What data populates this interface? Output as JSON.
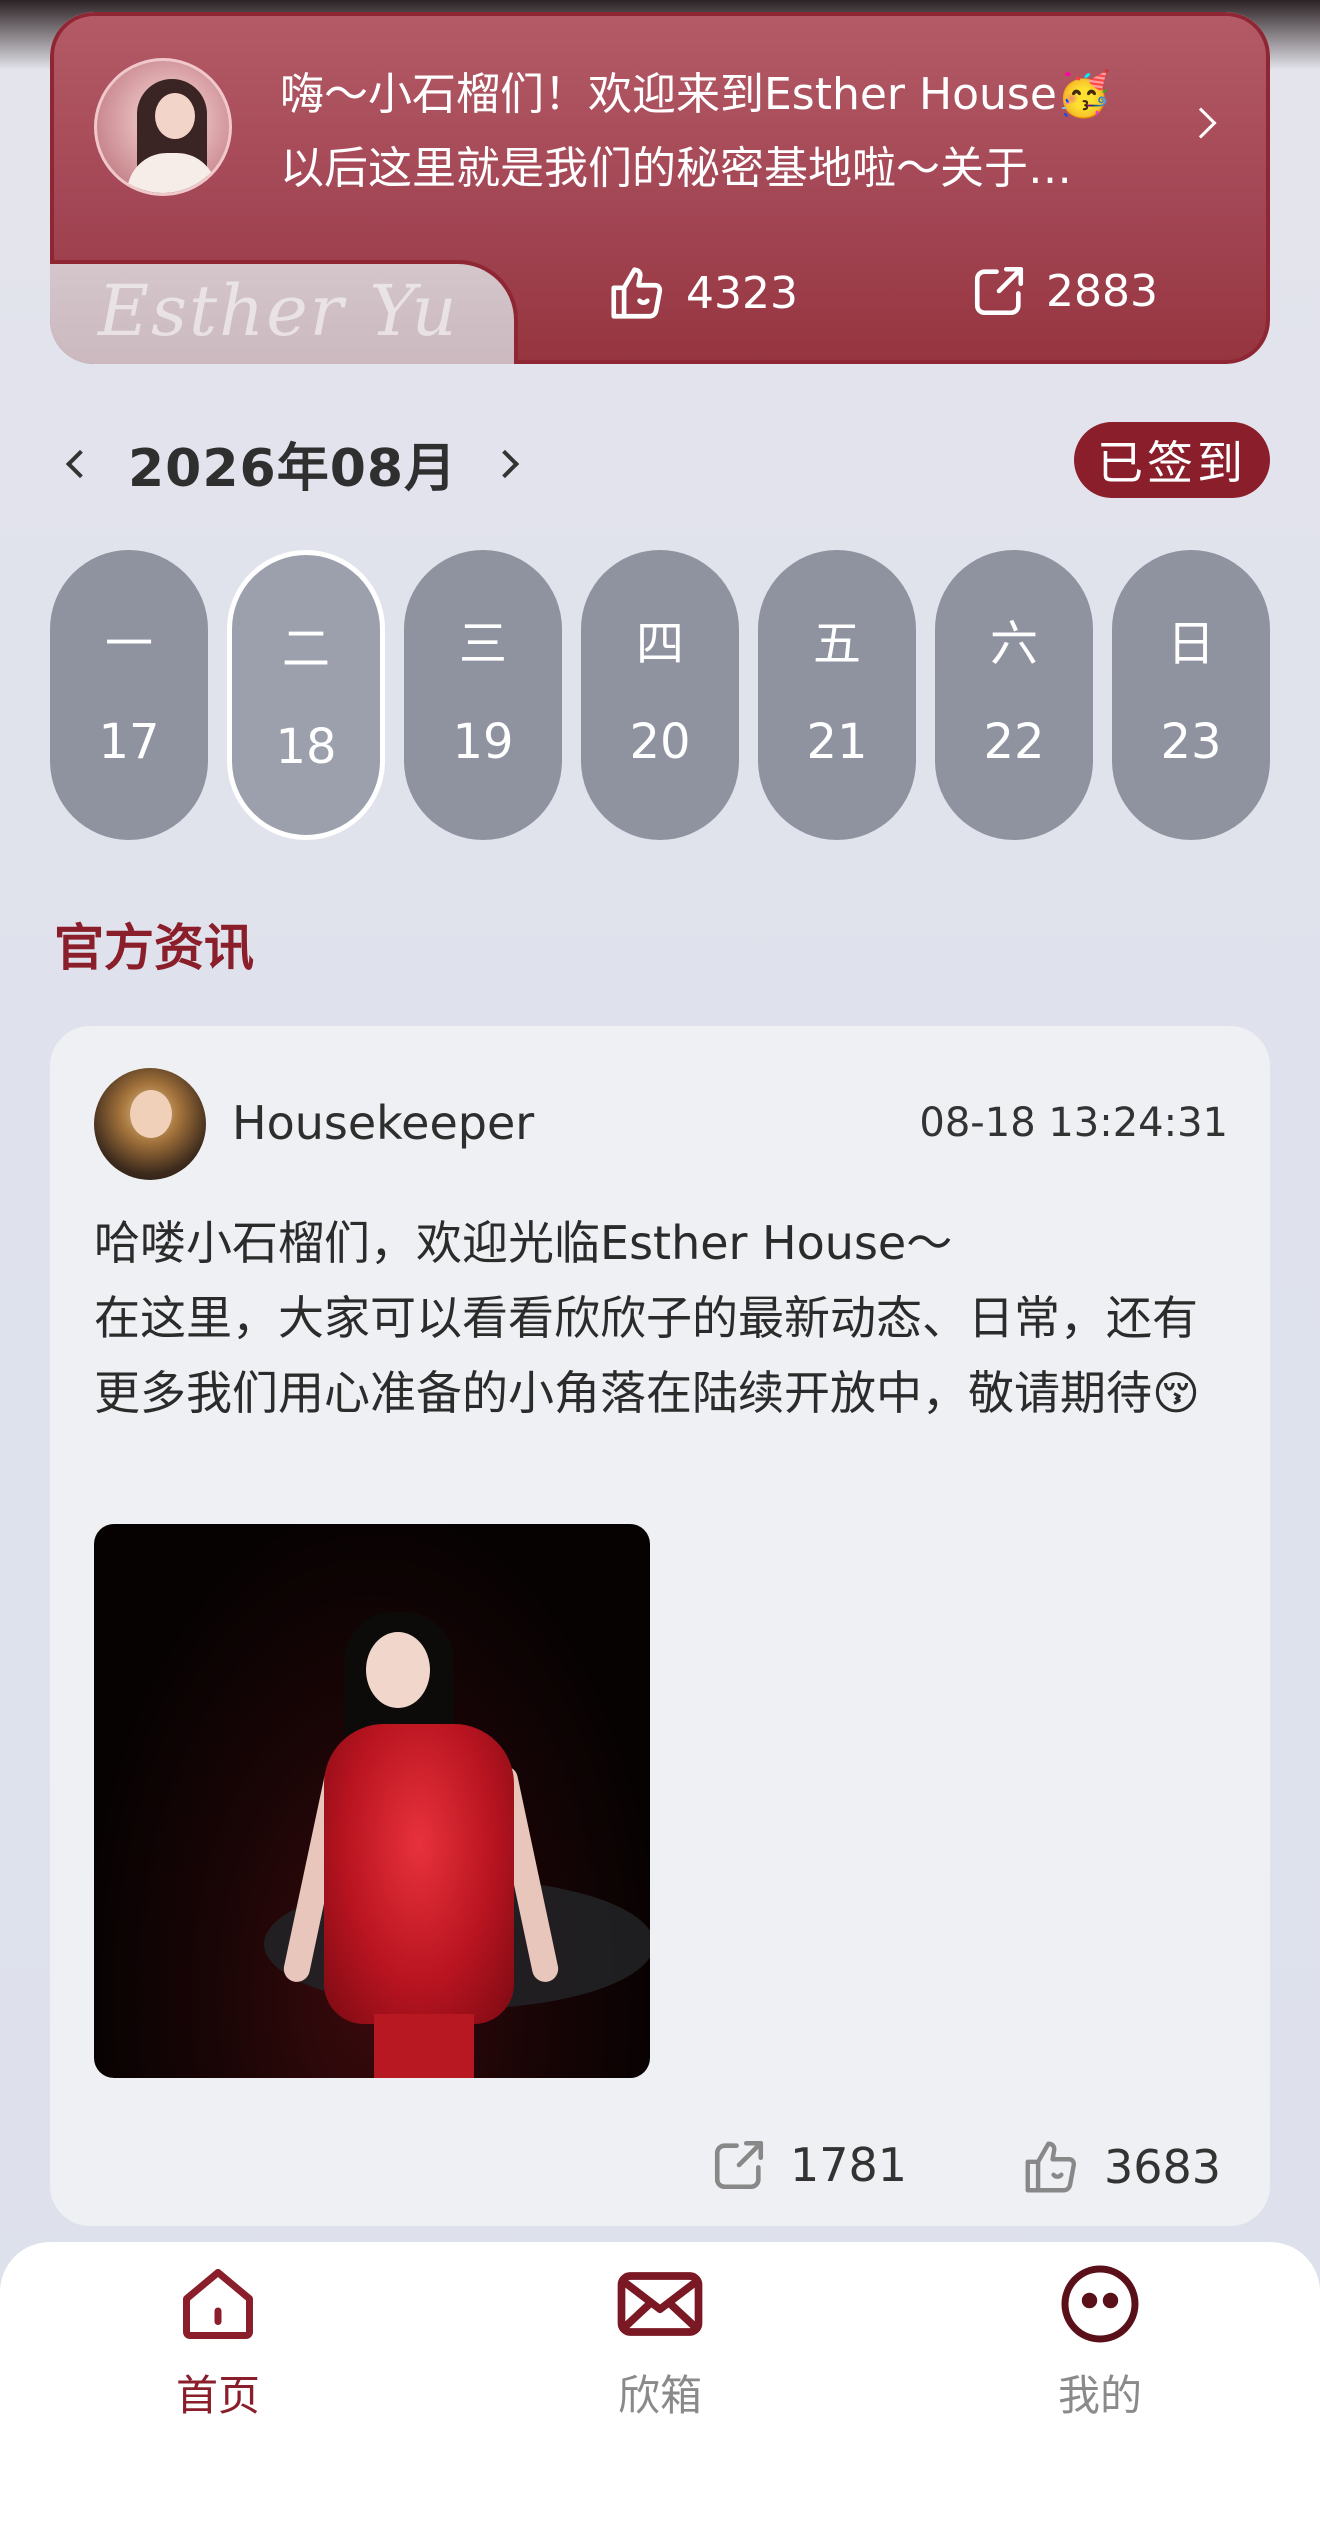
{
  "banner": {
    "line1": "嗨～小石榴们！欢迎来到Esther House🥳",
    "line2": "以后这里就是我们的秘密基地啦～关于…",
    "signature": "Esther Yu",
    "likes": "4323",
    "shares": "2883"
  },
  "calendar": {
    "month_label": "2026年08月",
    "signed_label": "已签到",
    "days": [
      {
        "weekday": "一",
        "date": "17"
      },
      {
        "weekday": "二",
        "date": "18"
      },
      {
        "weekday": "三",
        "date": "19"
      },
      {
        "weekday": "四",
        "date": "20"
      },
      {
        "weekday": "五",
        "date": "21"
      },
      {
        "weekday": "六",
        "date": "22"
      },
      {
        "weekday": "日",
        "date": "23"
      }
    ],
    "selected_date": "18"
  },
  "section": {
    "title": "官方资讯"
  },
  "post": {
    "author": "Housekeeper",
    "time": "08-18 13:24:31",
    "line1": "哈喽小石榴们，欢迎光临Esther House～",
    "line2": "在这里，大家可以看看欣欣子的最新动态、日常，还有更多我们用心准备的小角落在陆续开放中，敬请期待😚",
    "shares": "1781",
    "likes": "3683"
  },
  "tabs": [
    {
      "label": "首页",
      "icon": "home-icon",
      "active": true
    },
    {
      "label": "欣箱",
      "icon": "mail-icon",
      "active": false
    },
    {
      "label": "我的",
      "icon": "smiley-icon",
      "active": false
    }
  ],
  "colors": {
    "accent": "#8a1f2b",
    "day_pill": "#8e939f",
    "tab_inactive": "#8a8a8a"
  }
}
